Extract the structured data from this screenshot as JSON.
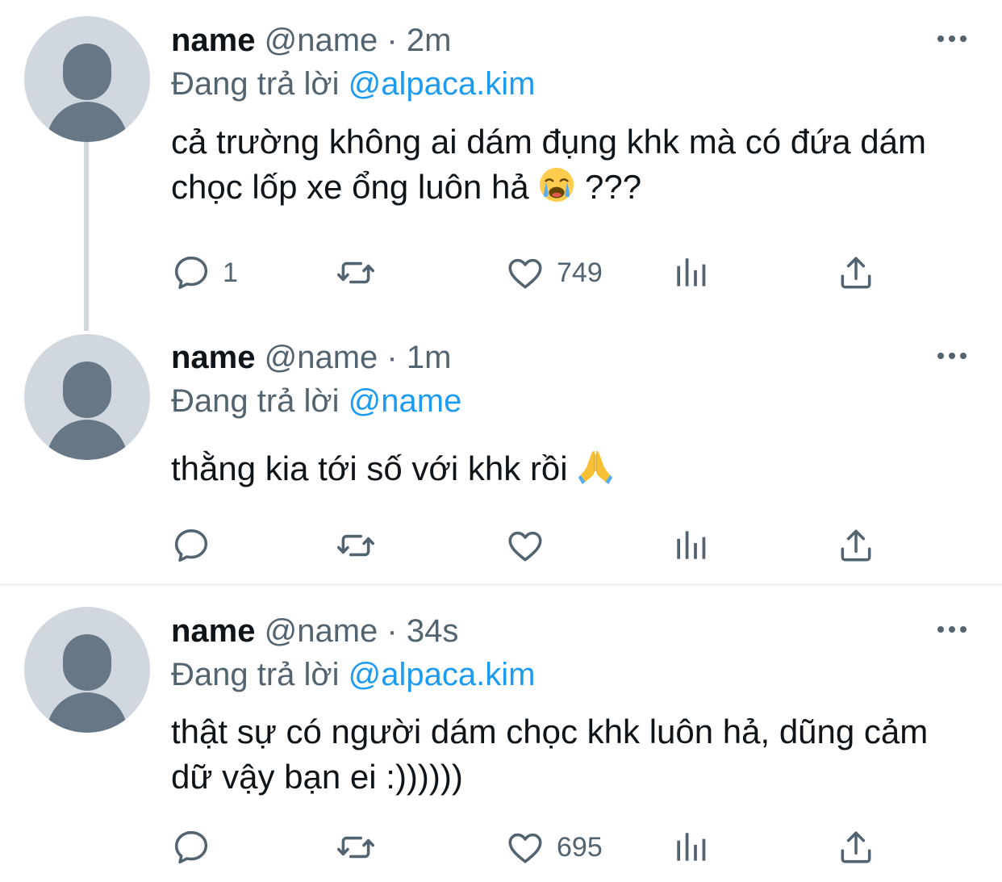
{
  "tweets": [
    {
      "name": "name",
      "handle": "@name",
      "separator": "·",
      "time": "2m",
      "replying_prefix": "Đang trả lời",
      "replying_to": "@alpaca.kim",
      "text": "cả trường không ai dám đụng khk mà có đứa dám chọc lốp xe ổng luôn hả",
      "text_suffix": "???",
      "emoji": "loudly-crying-face",
      "reply_count": "1",
      "retweet_count": "",
      "like_count": "749"
    },
    {
      "name": "name",
      "handle": "@name",
      "separator": "·",
      "time": "1m",
      "replying_prefix": "Đang trả lời",
      "replying_to": "@name",
      "text": "thằng kia tới số với khk rồi",
      "emoji": "folded-hands",
      "reply_count": "",
      "retweet_count": "",
      "like_count": ""
    },
    {
      "name": "name",
      "handle": "@name",
      "separator": "·",
      "time": "34s",
      "replying_prefix": "Đang trả lời",
      "replying_to": "@alpaca.kim",
      "text": "thật sự có người dám chọc khk luôn hả, dũng cảm dữ vậy bạn ei :))))))",
      "reply_count": "",
      "retweet_count": "",
      "like_count": "695"
    }
  ],
  "colors": {
    "text": "#0f1419",
    "secondary": "#536471",
    "link": "#1d9bf0",
    "avatar_bg": "#d0d7de",
    "avatar_fg": "#687785",
    "thread_line": "#cfd9de"
  },
  "icons": [
    "reply-icon",
    "retweet-icon",
    "like-icon",
    "views-icon",
    "share-icon",
    "more-options-icon"
  ]
}
